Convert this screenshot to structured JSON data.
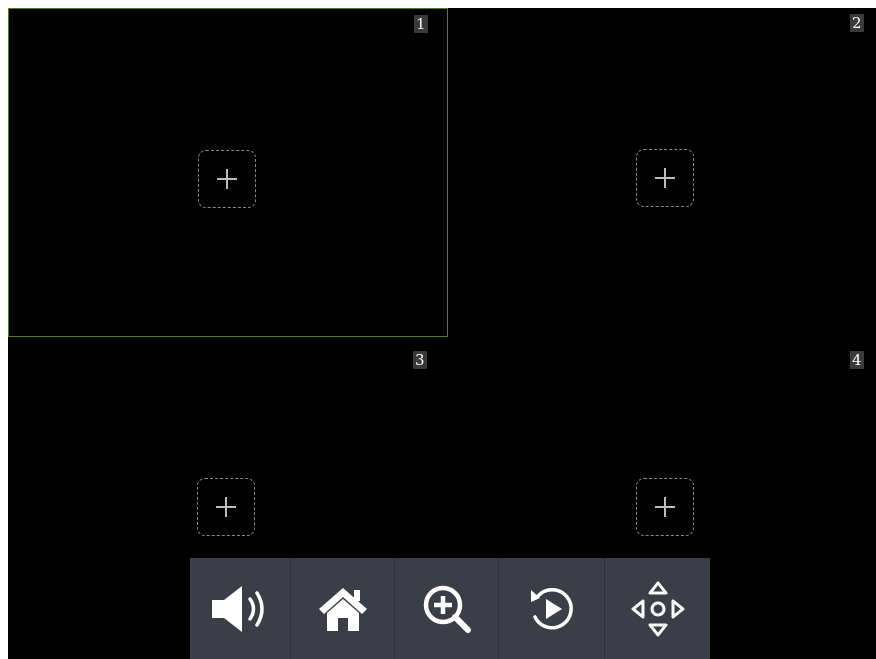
{
  "panes": [
    {
      "number": "1",
      "selected": true
    },
    {
      "number": "2",
      "selected": false
    },
    {
      "number": "3",
      "selected": false
    },
    {
      "number": "4",
      "selected": false
    }
  ],
  "toolbar": {
    "buttons": [
      {
        "name": "audio",
        "icon": "speaker-icon"
      },
      {
        "name": "home",
        "icon": "home-icon"
      },
      {
        "name": "zoom",
        "icon": "zoom-in-icon"
      },
      {
        "name": "playback",
        "icon": "replay-icon"
      },
      {
        "name": "ptz",
        "icon": "direction-pad-icon"
      }
    ]
  },
  "colors": {
    "background": "#000000",
    "selected_border": "#5a7a2a",
    "toolbar": "#3b3d47",
    "icon": "#ffffff",
    "add_border": "#8a8a8a"
  }
}
